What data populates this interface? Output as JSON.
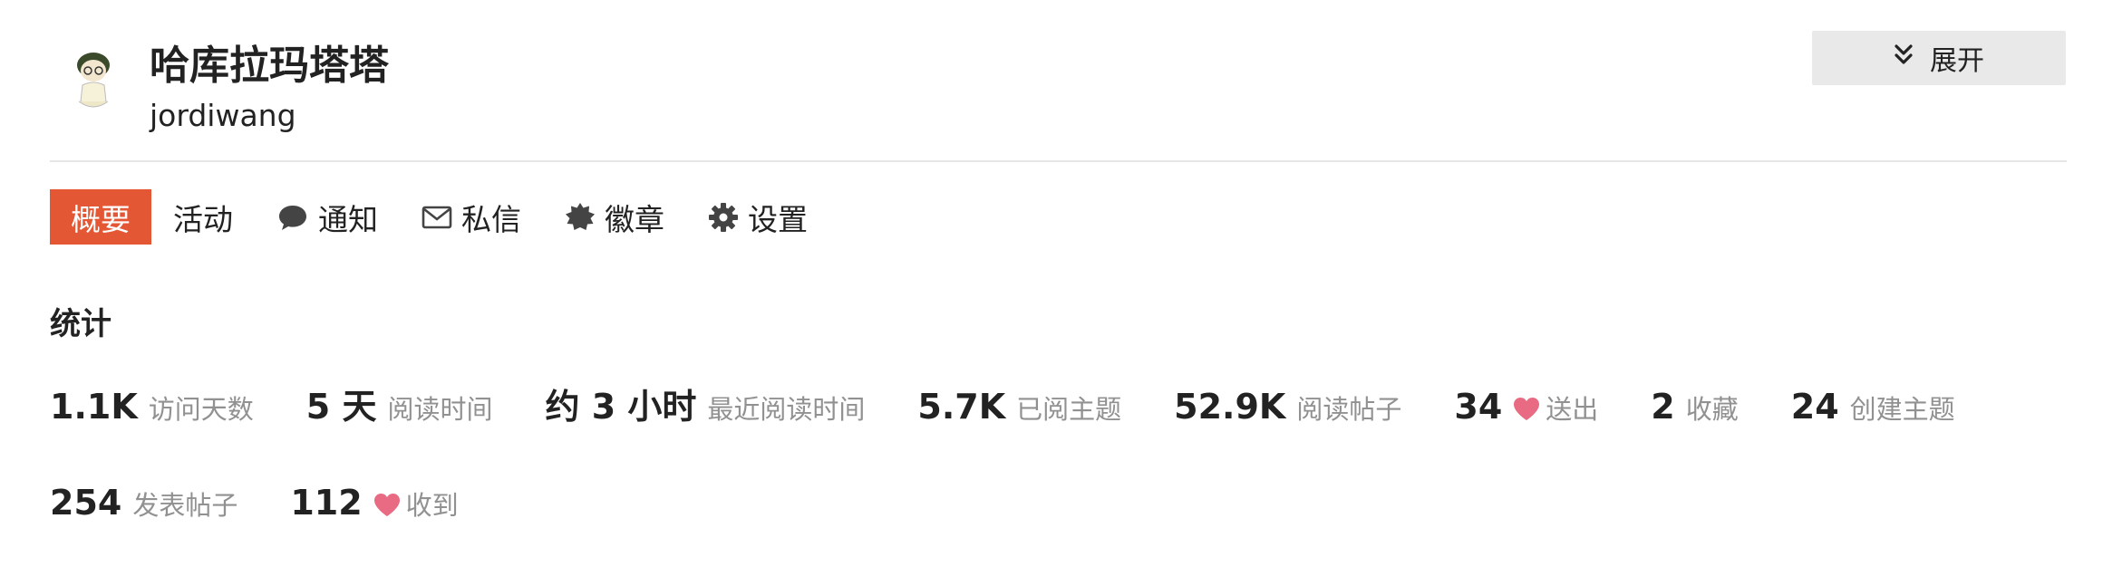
{
  "profile": {
    "display_name": "哈库拉玛塔塔",
    "username": "jordiwang",
    "expand_label": "展开"
  },
  "nav": {
    "items": [
      {
        "label": "概要",
        "icon": null,
        "active": true
      },
      {
        "label": "活动",
        "icon": null,
        "active": false
      },
      {
        "label": "通知",
        "icon": "comment-icon",
        "active": false
      },
      {
        "label": "私信",
        "icon": "envelope-icon",
        "active": false
      },
      {
        "label": "徽章",
        "icon": "badge-icon",
        "active": false
      },
      {
        "label": "设置",
        "icon": "gear-icon",
        "active": false
      }
    ]
  },
  "stats": {
    "title": "统计",
    "items": [
      {
        "value": "1.1K",
        "label": "访问天数",
        "heart": false
      },
      {
        "value": "5 天",
        "label": "阅读时间",
        "heart": false
      },
      {
        "value": "约 3 小时",
        "label": "最近阅读时间",
        "heart": false
      },
      {
        "value": "5.7K",
        "label": "已阅主题",
        "heart": false
      },
      {
        "value": "52.9K",
        "label": "阅读帖子",
        "heart": false
      },
      {
        "value": "34",
        "label": "送出",
        "heart": true
      },
      {
        "value": "2",
        "label": "收藏",
        "heart": false
      },
      {
        "value": "24",
        "label": "创建主题",
        "heart": false
      },
      {
        "value": "254",
        "label": "发表帖子",
        "heart": false
      },
      {
        "value": "112",
        "label": "收到",
        "heart": true
      }
    ]
  },
  "colors": {
    "accent": "#e45735",
    "heart": "#e86a83",
    "muted_text": "#919191",
    "button_bg": "#e9e9e9"
  }
}
